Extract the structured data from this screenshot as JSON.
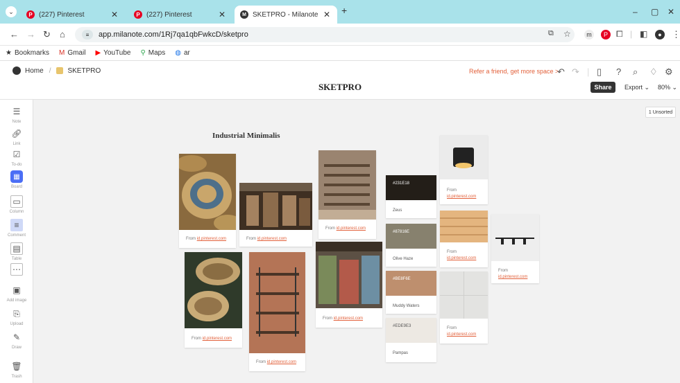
{
  "browser": {
    "tabs": [
      {
        "label": "(227) Pinterest",
        "icon": "pinterest-icon"
      },
      {
        "label": "(227) Pinterest",
        "icon": "pinterest-icon"
      },
      {
        "label": "SKETPRO - Milanote",
        "icon": "milanote-icon"
      }
    ],
    "new_tab": "+",
    "url": "app.milanote.com/1Rj7qa1qbFwkcD/sketpro",
    "bookmarks": [
      {
        "label": "Bookmarks",
        "icon": "star-icon"
      },
      {
        "label": "Gmail",
        "icon": "gmail-icon"
      },
      {
        "label": "YouTube",
        "icon": "youtube-icon"
      },
      {
        "label": "Maps",
        "icon": "maps-icon"
      },
      {
        "label": "ar",
        "icon": "globe-icon"
      }
    ]
  },
  "app": {
    "breadcrumb_home": "Home",
    "breadcrumb_board": "SKETPRO",
    "refer": "Refer a friend, get more space >",
    "title": "SKETPRO",
    "share": "Share",
    "export": "Export ⌄",
    "zoom": "80% ⌄",
    "unsorted": "1 Unsorted"
  },
  "tools": [
    {
      "label": "Note",
      "icon": "note-icon"
    },
    {
      "label": "Link",
      "icon": "link-icon"
    },
    {
      "label": "To-do",
      "icon": "todo-icon"
    },
    {
      "label": "Board",
      "icon": "board-icon"
    },
    {
      "label": "Column",
      "icon": "column-icon"
    },
    {
      "label": "Comment",
      "icon": "comment-icon"
    },
    {
      "label": "Table",
      "icon": "table-icon"
    },
    {
      "label": "",
      "icon": "more-icon"
    },
    {
      "label": "Add image",
      "icon": "image-icon"
    },
    {
      "label": "Upload",
      "icon": "upload-icon"
    },
    {
      "label": "Draw",
      "icon": "pen-icon"
    },
    {
      "label": "Trash",
      "icon": "trash-icon"
    }
  ],
  "board": {
    "heading": "Industrial Minimalis",
    "from_prefix": "From",
    "source": "id.pinterest.com",
    "swatches": [
      {
        "hex": "#231E18",
        "name": "Zeus",
        "color": "#231E18"
      },
      {
        "hex": "#87816E",
        "name": "Olive Haze",
        "color": "#87816E"
      },
      {
        "hex": "#BE8F6E",
        "name": "Muddy Waters",
        "color": "#BE8F6E"
      },
      {
        "hex": "#EDE9E3",
        "name": "Pampas",
        "color": "#EDE9E3"
      }
    ]
  }
}
